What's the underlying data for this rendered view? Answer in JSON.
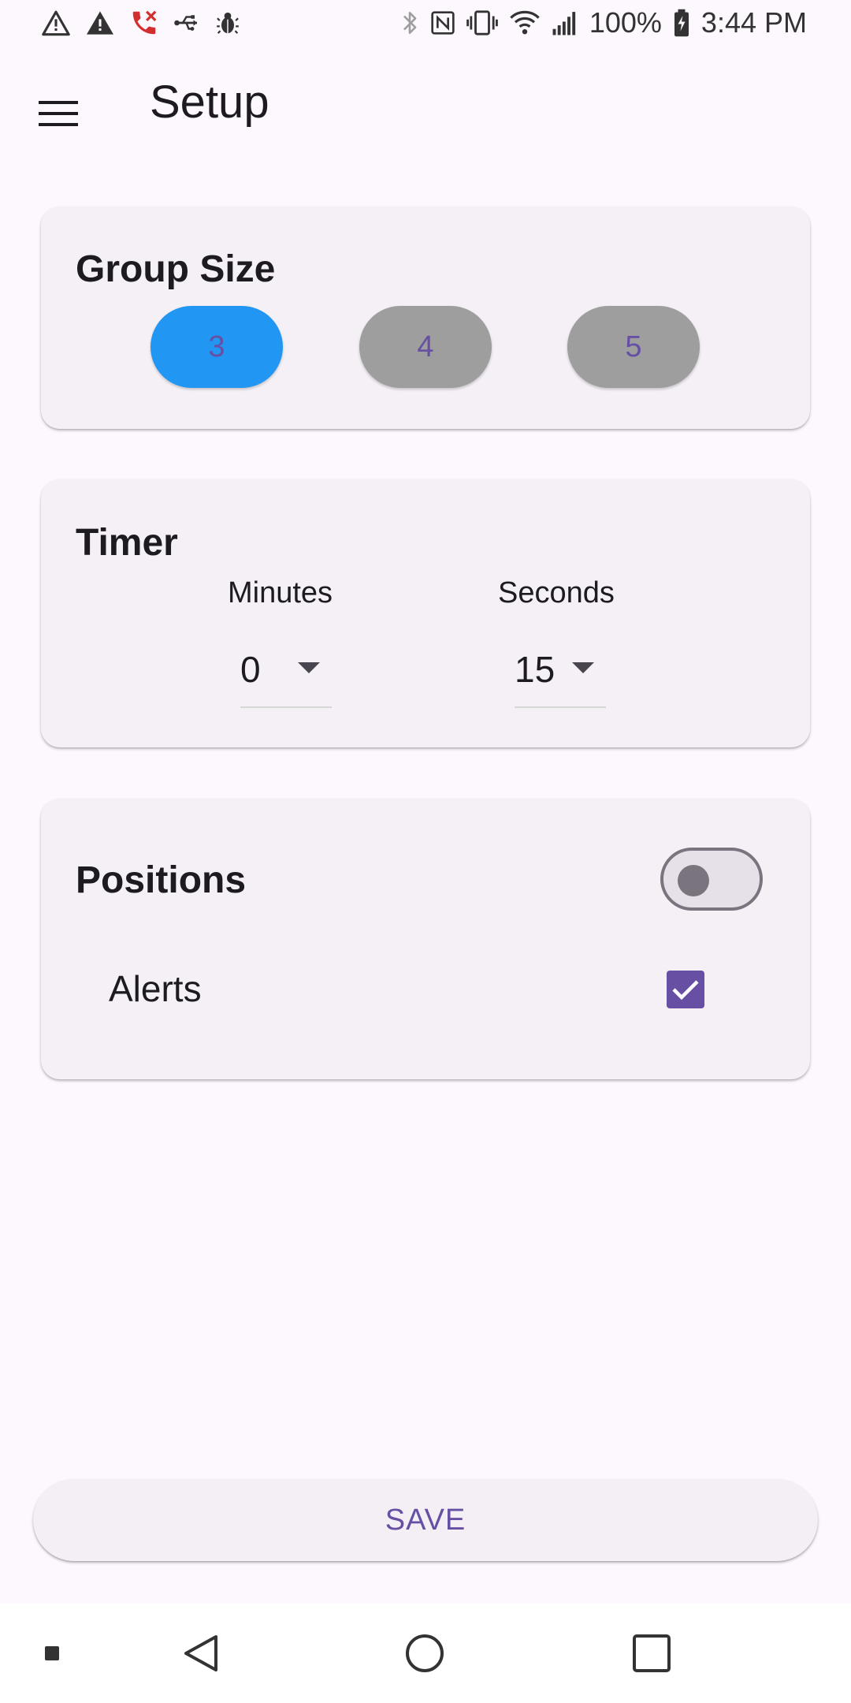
{
  "status_bar": {
    "battery": "100%",
    "time": "3:44 PM"
  },
  "app_bar": {
    "title": "Setup"
  },
  "group_size": {
    "title": "Group Size",
    "options": [
      "3",
      "4",
      "5"
    ],
    "selected": "3",
    "selected_color": "#2196F3",
    "unselected_color": "#9E9E9E"
  },
  "timer": {
    "title": "Timer",
    "minutes_label": "Minutes",
    "seconds_label": "Seconds",
    "minutes_value": "0",
    "seconds_value": "15"
  },
  "positions": {
    "title": "Positions",
    "toggle_on": false,
    "alerts_label": "Alerts",
    "alerts_checked": true
  },
  "save_button": {
    "label": "SAVE"
  },
  "colors": {
    "accent": "#6750A4",
    "background": "#FDF7FE",
    "card": "#F4F0F6"
  }
}
